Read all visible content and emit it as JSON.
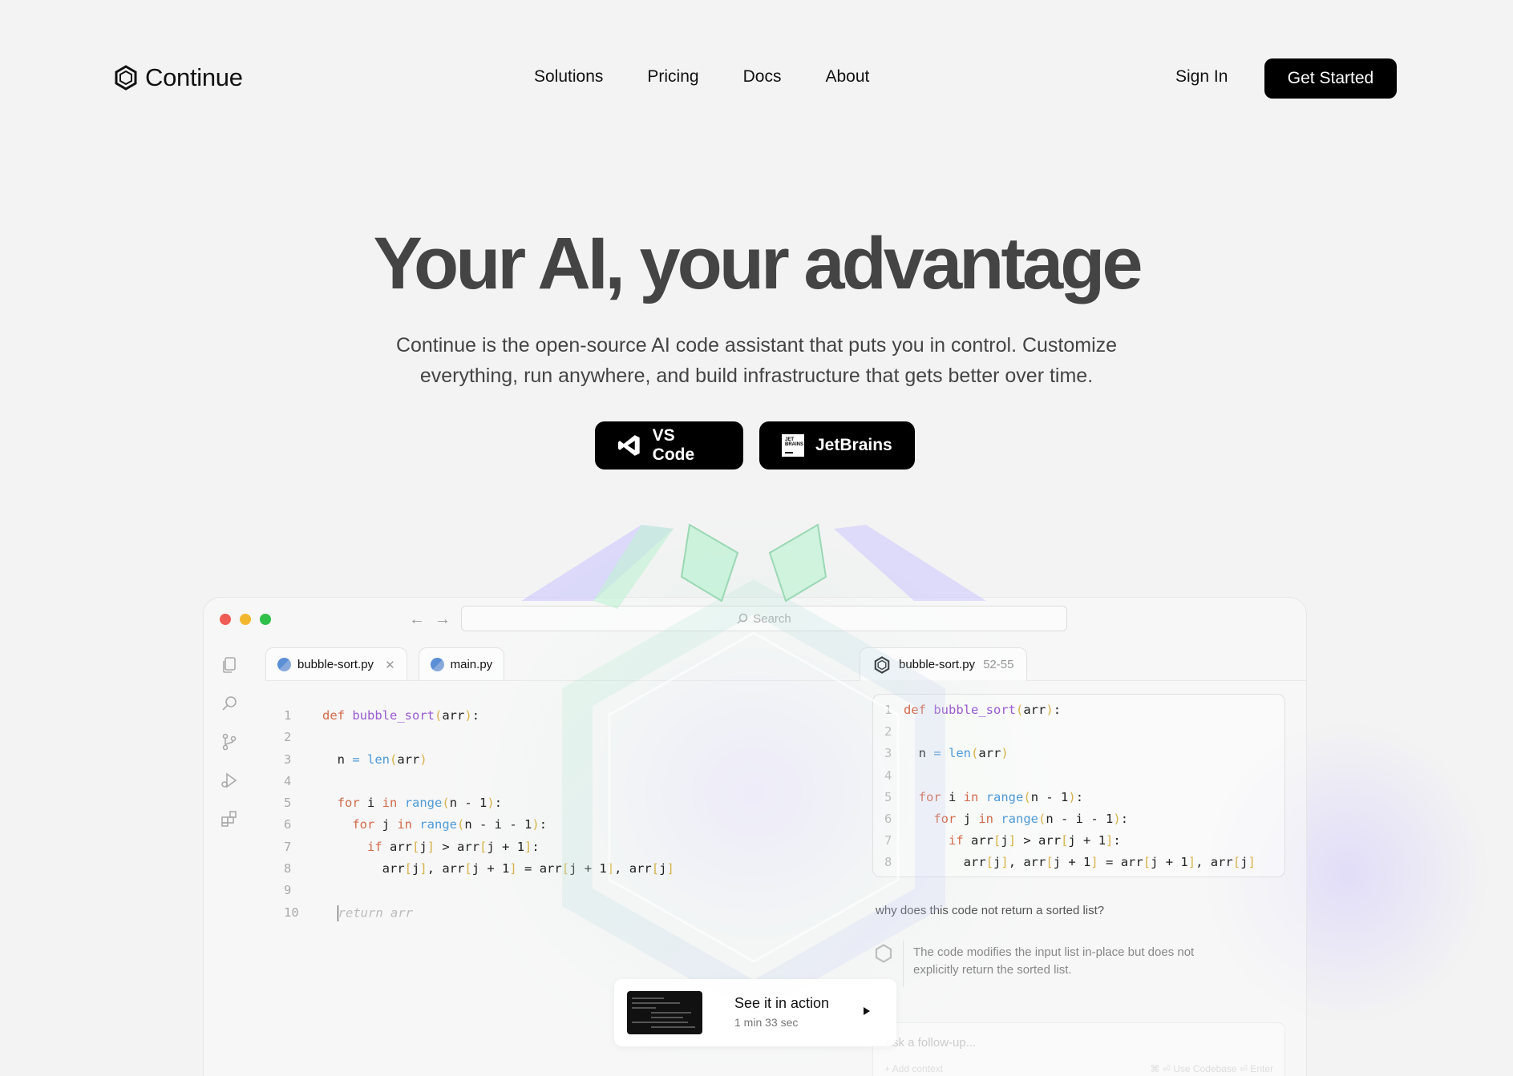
{
  "nav": {
    "logo_text": "Continue",
    "links": [
      "Solutions",
      "Pricing",
      "Docs",
      "About"
    ],
    "sign_in": "Sign In",
    "get_started": "Get Started"
  },
  "hero": {
    "title": "Your AI, your advantage",
    "subtitle_line1": "Continue is the open-source AI code assistant that puts you in control. Customize",
    "subtitle_line2": "everything, run anywhere, and build infrastructure that gets better over time.",
    "buttons": {
      "vscode": "VS Code",
      "jetbrains": "JetBrains"
    }
  },
  "ide": {
    "search_placeholder": "Search",
    "tabs": [
      "bubble-sort.py",
      "main.py"
    ],
    "chat_tab": {
      "file": "bubble-sort.py",
      "range": "52-55"
    },
    "question": "why does this code not return a sorted list?",
    "answer": "The code modifies the input list in-place but does not explicitly return the sorted list.",
    "followup_placeholder": "Ask a follow-up...",
    "followup_context": "+ Add context",
    "followup_hint": "⌘ ⏎ Use Codebase   ⏎ Enter"
  },
  "action": {
    "title": "See it in action",
    "duration": "1 min 33 sec"
  },
  "colors": {
    "brand": "#000000",
    "background": "#f3f3f3",
    "keyword": "#d26a4b",
    "function": "#9a5bd0",
    "builtin": "#4f9ad8",
    "paren": "#d8b24a"
  }
}
